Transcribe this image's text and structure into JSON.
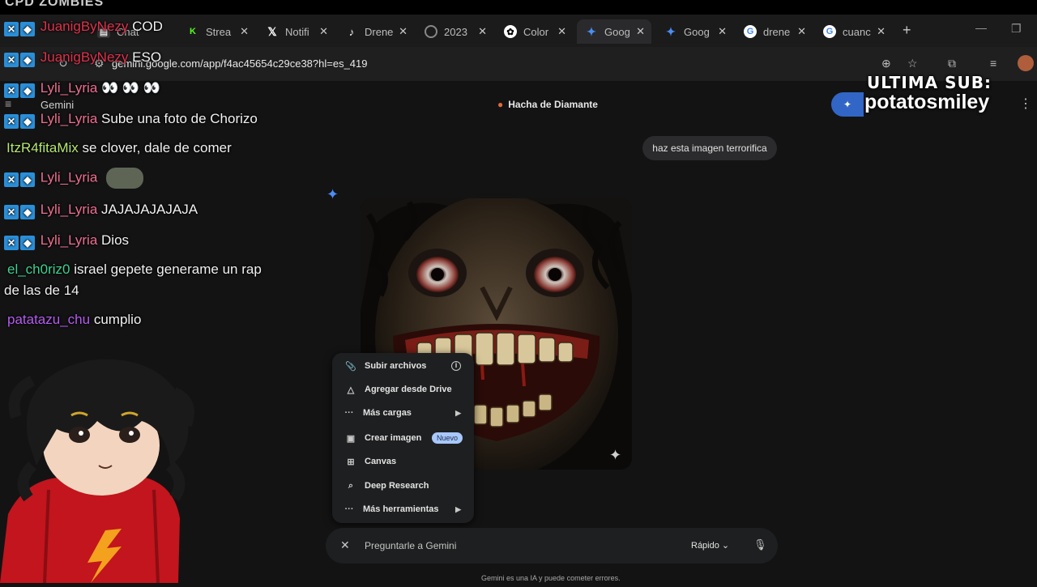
{
  "stream_title": "CPD ZOMBIES",
  "tabs": [
    {
      "label": "Chat",
      "icon": "chat-icon",
      "color": "#1b1b1c"
    },
    {
      "label": "Strea",
      "icon": "kick-icon",
      "color": "#53fc18"
    },
    {
      "label": "Notifi",
      "icon": "x-icon",
      "color": "#000000"
    },
    {
      "label": "Drene",
      "icon": "tiktok-icon",
      "color": "#000000"
    },
    {
      "label": "2023",
      "icon": "globe-icon",
      "color": "#888888"
    },
    {
      "label": "Color",
      "icon": "chatgpt-icon",
      "color": "#ffffff"
    },
    {
      "label": "Goog",
      "icon": "gemini-icon",
      "color": "#4c8df6"
    },
    {
      "label": "Goog",
      "icon": "gemini-icon",
      "color": "#4c8df6"
    },
    {
      "label": "drene",
      "icon": "google-icon",
      "color": "#ffffff"
    },
    {
      "label": "cuanc",
      "icon": "google-icon",
      "color": "#ffffff"
    }
  ],
  "address": {
    "url": "gemini.google.com/app/f4ac45654c29ce38?hl=es_419"
  },
  "gemini": {
    "app_label": "Gemini",
    "conversation_title": "Hacha de Diamante",
    "user_message": "haz esta imagen terrorifica",
    "upload_menu": [
      {
        "label": "Subir archivos",
        "icon": "paperclip-icon"
      },
      {
        "label": "Agregar desde Drive",
        "icon": "drive-icon"
      },
      {
        "label": "Más cargas",
        "icon": "more-dots-icon"
      },
      {
        "label": "Crear imagen",
        "icon": "image-icon",
        "badge": "Nuevo"
      },
      {
        "label": "Canvas",
        "icon": "canvas-icon"
      },
      {
        "label": "Deep Research",
        "icon": "research-icon"
      },
      {
        "label": "Más herramientas",
        "icon": "more-dots-icon"
      }
    ],
    "prompt_placeholder": "Preguntarle a Gemini",
    "mode": "Rápido",
    "disclaimer": "Gemini es una IA y puede cometer errores."
  },
  "chat": [
    {
      "user": "JuanigByNezy",
      "message": "COD",
      "color": "#e0324b",
      "badges": true
    },
    {
      "user": "JuanigByNezy",
      "message": "ESO",
      "color": "#e0324b",
      "badges": true
    },
    {
      "user": "Lyli_Lyria",
      "message": "👀 👀 👀",
      "color": "#f06f92",
      "badges": true
    },
    {
      "user": "Lyli_Lyria",
      "message": "Sube una foto de Chorizo",
      "color": "#f06f92",
      "badges": true
    },
    {
      "user": "ItzR4fitaMix",
      "message": "se clover, dale de comer",
      "color": "#b6e86d",
      "badges": false
    },
    {
      "user": "Lyli_Lyria",
      "message": "",
      "color": "#f06f92",
      "badges": true,
      "emote": true
    },
    {
      "user": "Lyli_Lyria",
      "message": "JAJAJAJAJAJA",
      "color": "#f06f92",
      "badges": true
    },
    {
      "user": "Lyli_Lyria",
      "message": "Dios",
      "color": "#f06f92",
      "badges": true
    },
    {
      "user": "el_ch0riz0",
      "message": "israel gepete generame un rap",
      "message2": "de las de 14",
      "color": "#3fd191",
      "badges": false
    },
    {
      "user": "patatazu_chu",
      "message": "cumplio",
      "color": "#b65cf0",
      "badges": false
    }
  ],
  "sub_banner": {
    "line1": "ULTIMA SUB:",
    "line2": "potatosmiley"
  }
}
